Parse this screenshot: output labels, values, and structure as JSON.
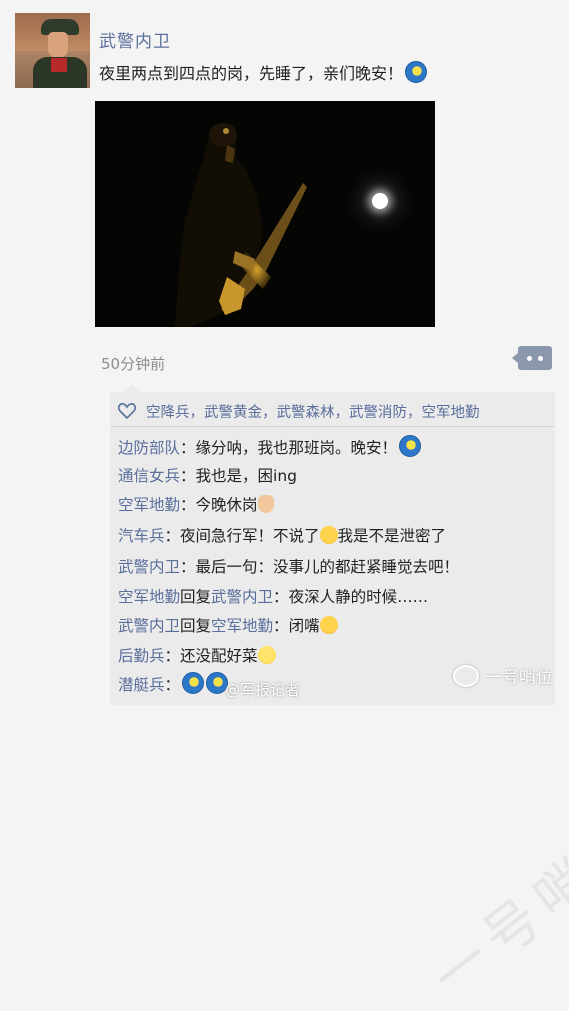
{
  "post": {
    "username": "武警内卫",
    "text": "夜里两点到四点的岗，先睡了，亲们晚安！",
    "text_emoji": "moon-emoji",
    "time": "50分钟前"
  },
  "likes": {
    "icon": "heart-outline-icon",
    "names": "空降兵，武警黄金，武警森林，武警消防，空军地勤"
  },
  "comments": [
    {
      "name": "边防部队",
      "sep": "：",
      "text": "缘分呐，我也那班岗。晚安！",
      "emoji": "moon-emoji"
    },
    {
      "name": "通信女兵",
      "sep": "：",
      "text": "我也是，困ing"
    },
    {
      "name": "空军地勤",
      "sep": "：",
      "text": "今晚休岗",
      "emoji": "victory-hand-emoji"
    },
    {
      "name": "汽车兵",
      "sep": "：",
      "text": "夜间急行军！不说了",
      "emoji": "shh-emoji",
      "text2": "我是不是泄密了"
    },
    {
      "name": "武警内卫",
      "sep": "：",
      "text": "最后一句：没事儿的都赶紧睡觉去吧！"
    },
    {
      "name": "空军地勤",
      "reply_word": "回复",
      "reply_to": "武警内卫",
      "sep": "：",
      "text": "夜深人静的时候……"
    },
    {
      "name": "武警内卫",
      "reply_word": "回复",
      "reply_to": "空军地勤",
      "sep": "：",
      "text": "闭嘴",
      "emoji": "tongue-emoji"
    },
    {
      "name": "后勤兵",
      "sep": "：",
      "text": "还没配好菜",
      "emoji": "sleepy-emoji"
    },
    {
      "name": "潜艇兵",
      "sep": "：",
      "text": "",
      "emoji": "moon-emoji",
      "emoji2": "moon-emoji"
    }
  ],
  "watermarks": {
    "left": "@军报记者",
    "right": "一号哨位",
    "background": "一号哨位"
  },
  "colors": {
    "name_link": "#5a6f9c",
    "more_button": "#8b97ad",
    "comment_bg": "#ebebeb",
    "page_bg": "#f4f4f4"
  }
}
